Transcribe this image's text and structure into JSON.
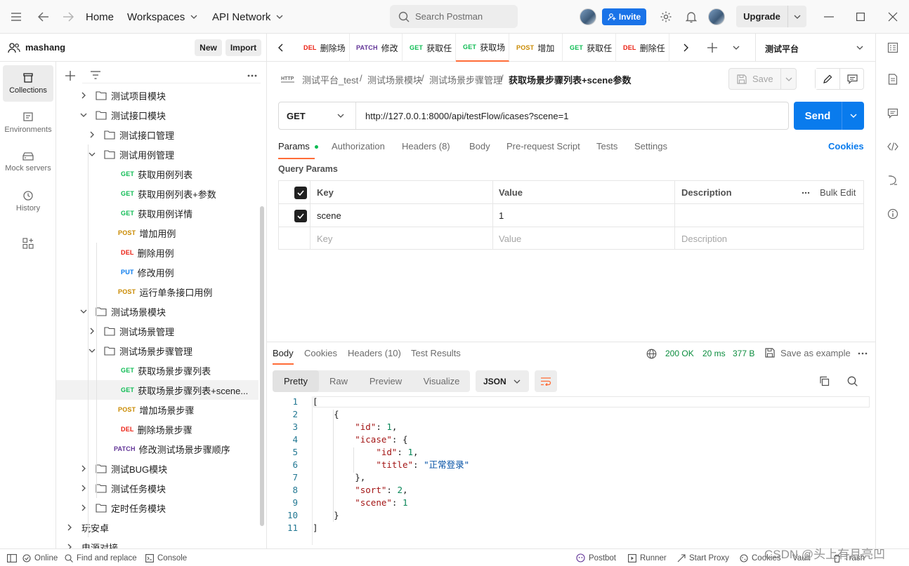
{
  "topbar": {
    "home": "Home",
    "workspaces": "Workspaces",
    "api_network": "API Network",
    "search_placeholder": "Search Postman",
    "invite": "Invite",
    "upgrade": "Upgrade"
  },
  "workspace": {
    "name": "mashang",
    "new_label": "New",
    "import_label": "Import"
  },
  "leftnav": {
    "items": [
      {
        "label": "Collections",
        "icon": "collections-icon"
      },
      {
        "label": "Environments",
        "icon": "environments-icon"
      },
      {
        "label": "Mock servers",
        "icon": "mock-servers-icon"
      },
      {
        "label": "History",
        "icon": "history-icon"
      }
    ]
  },
  "tree": [
    {
      "label": "测试项目模块",
      "type": "folder",
      "expanded": false
    },
    {
      "label": "测试接口模块",
      "type": "folder",
      "expanded": true
    },
    {
      "label": "测试接口管理",
      "type": "folder",
      "expanded": false
    },
    {
      "label": "测试用例管理",
      "type": "folder",
      "expanded": true
    },
    {
      "label": "获取用例列表",
      "type": "request",
      "method": "GET"
    },
    {
      "label": "获取用例列表+参数",
      "type": "request",
      "method": "GET"
    },
    {
      "label": "获取用例详情",
      "type": "request",
      "method": "GET"
    },
    {
      "label": "增加用例",
      "type": "request",
      "method": "POST"
    },
    {
      "label": "删除用例",
      "type": "request",
      "method": "DEL"
    },
    {
      "label": "修改用例",
      "type": "request",
      "method": "PUT"
    },
    {
      "label": "运行单条接口用例",
      "type": "request",
      "method": "POST"
    },
    {
      "label": "测试场景模块",
      "type": "folder",
      "expanded": true
    },
    {
      "label": "测试场景管理",
      "type": "folder",
      "expanded": false
    },
    {
      "label": "测试场景步骤管理",
      "type": "folder",
      "expanded": true
    },
    {
      "label": "获取场景步骤列表",
      "type": "request",
      "method": "GET"
    },
    {
      "label": "获取场景步骤列表+scene...",
      "type": "request",
      "method": "GET"
    },
    {
      "label": "增加场景步骤",
      "type": "request",
      "method": "POST"
    },
    {
      "label": "删除场景步骤",
      "type": "request",
      "method": "DEL"
    },
    {
      "label": "修改测试场景步骤顺序",
      "type": "request",
      "method": "PATCH"
    },
    {
      "label": "测试BUG模块",
      "type": "folder",
      "expanded": false
    },
    {
      "label": "测试任务模块",
      "type": "folder",
      "expanded": false
    },
    {
      "label": "定时任务模块",
      "type": "folder",
      "expanded": false
    },
    {
      "label": "玩安卓",
      "type": "collection",
      "expanded": false
    },
    {
      "label": "电源对接",
      "type": "collection",
      "expanded": false
    }
  ],
  "tabs": [
    {
      "method": "DEL",
      "label": "删除场"
    },
    {
      "method": "PATCH",
      "label": "修改"
    },
    {
      "method": "GET",
      "label": "获取任"
    },
    {
      "method": "GET",
      "label": "获取场"
    },
    {
      "method": "POST",
      "label": "增加"
    },
    {
      "method": "GET",
      "label": "获取任"
    },
    {
      "method": "DEL",
      "label": "删除任"
    }
  ],
  "environment": "测试平台",
  "breadcrumb": [
    "测试平台_test",
    "测试场景模块",
    "测试场景步骤管理",
    "获取场景步骤列表+scene参数"
  ],
  "save_label": "Save",
  "request": {
    "method": "GET",
    "url": "http://127.0.0.1:8000/api/testFlow/icases?scene=1",
    "send_label": "Send",
    "tabs": [
      "Params",
      "Authorization",
      "Headers (8)",
      "Body",
      "Pre-request Script",
      "Tests",
      "Settings"
    ],
    "cookies_label": "Cookies",
    "query_params_title": "Query Params",
    "columns": {
      "key": "Key",
      "value": "Value",
      "description": "Description",
      "bulk_edit": "Bulk Edit"
    },
    "params": [
      {
        "key": "scene",
        "value": "1",
        "description": ""
      }
    ],
    "placeholders": {
      "key": "Key",
      "value": "Value",
      "description": "Description"
    }
  },
  "response": {
    "tabs": [
      "Body",
      "Cookies",
      "Headers (10)",
      "Test Results"
    ],
    "status": "200 OK",
    "time": "20 ms",
    "size": "377 B",
    "save_example": "Save as example",
    "views": [
      "Pretty",
      "Raw",
      "Preview",
      "Visualize"
    ],
    "format": "JSON",
    "code_lines": [
      "1",
      "2",
      "3",
      "4",
      "5",
      "6",
      "7",
      "8",
      "9",
      "10",
      "11"
    ]
  },
  "statusbar": {
    "online": "Online",
    "find_replace": "Find and replace",
    "console": "Console",
    "postbot": "Postbot",
    "runner": "Runner",
    "start_proxy": "Start Proxy",
    "cookies": "Cookies",
    "vault": "Vault",
    "trash": "Trash",
    "watermark": "CSDN @头上有月亮凹"
  },
  "colors": {
    "accent_blue": "#097bed",
    "orange": "#ff6c37",
    "get": "#0cbb52",
    "post": "#c98a00",
    "del": "#eb2013",
    "put": "#097bed",
    "patch": "#623497"
  }
}
